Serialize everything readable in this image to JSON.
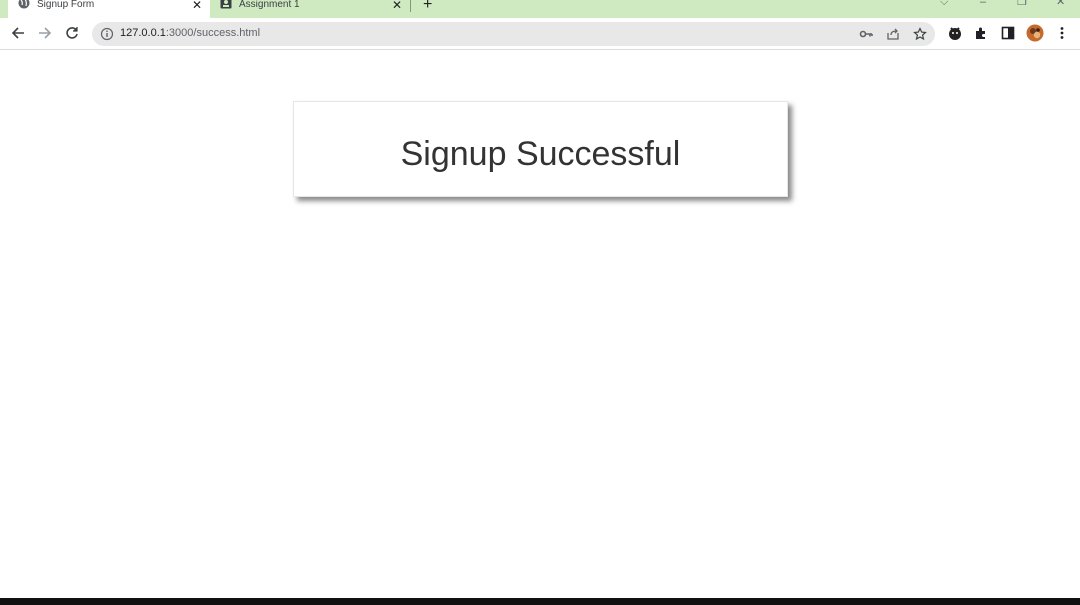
{
  "browser": {
    "tabs": [
      {
        "title": "Signup Form",
        "active": true,
        "favicon": "globe-icon"
      },
      {
        "title": "Assignment 1",
        "active": false,
        "favicon": "contact-card-icon"
      }
    ],
    "url": {
      "host": "127.0.0.1",
      "path": ":3000/success.html"
    },
    "theme_color": "#cfeac1"
  },
  "page": {
    "heading": "Signup Successful"
  }
}
